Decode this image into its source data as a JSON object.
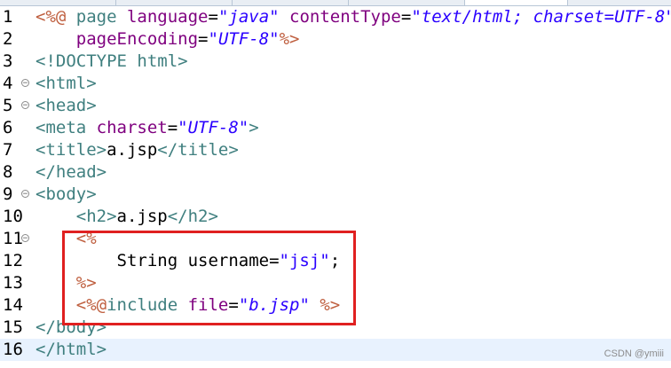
{
  "editor": {
    "lines": [
      {
        "num": "1",
        "fold": false,
        "segments": [
          {
            "t": "<%@ ",
            "c": "jsp"
          },
          {
            "t": "page ",
            "c": "tag"
          },
          {
            "t": "language",
            "c": "attr"
          },
          {
            "t": "=",
            "c": "plain"
          },
          {
            "t": "\"java\"",
            "c": "strit"
          },
          {
            "t": " ",
            "c": "plain"
          },
          {
            "t": "contentType",
            "c": "attr"
          },
          {
            "t": "=",
            "c": "plain"
          },
          {
            "t": "\"text/html; charset=UTF-8\"",
            "c": "strit"
          }
        ]
      },
      {
        "num": "2",
        "fold": false,
        "segments": [
          {
            "t": "    ",
            "c": "plain"
          },
          {
            "t": "pageEncoding",
            "c": "attr"
          },
          {
            "t": "=",
            "c": "plain"
          },
          {
            "t": "\"UTF-8\"",
            "c": "strit"
          },
          {
            "t": "%>",
            "c": "jsp"
          }
        ]
      },
      {
        "num": "3",
        "fold": false,
        "segments": [
          {
            "t": "<!DOCTYPE html>",
            "c": "tag"
          }
        ]
      },
      {
        "num": "4",
        "fold": true,
        "segments": [
          {
            "t": "<html>",
            "c": "tag"
          }
        ]
      },
      {
        "num": "5",
        "fold": true,
        "segments": [
          {
            "t": "<head>",
            "c": "tag"
          }
        ]
      },
      {
        "num": "6",
        "fold": false,
        "segments": [
          {
            "t": "<meta ",
            "c": "tag"
          },
          {
            "t": "charset",
            "c": "attr"
          },
          {
            "t": "=",
            "c": "plain"
          },
          {
            "t": "\"UTF-8\"",
            "c": "strit"
          },
          {
            "t": ">",
            "c": "tag"
          }
        ]
      },
      {
        "num": "7",
        "fold": false,
        "segments": [
          {
            "t": "<title>",
            "c": "tag"
          },
          {
            "t": "a.jsp",
            "c": "plain"
          },
          {
            "t": "</title>",
            "c": "tag"
          }
        ]
      },
      {
        "num": "8",
        "fold": false,
        "segments": [
          {
            "t": "</head>",
            "c": "tag"
          }
        ]
      },
      {
        "num": "9",
        "fold": true,
        "segments": [
          {
            "t": "<body>",
            "c": "tag"
          }
        ]
      },
      {
        "num": "10",
        "fold": false,
        "segments": [
          {
            "t": "    ",
            "c": "plain"
          },
          {
            "t": "<h2>",
            "c": "tag"
          },
          {
            "t": "a.jsp",
            "c": "plain"
          },
          {
            "t": "</h2>",
            "c": "tag"
          }
        ]
      },
      {
        "num": "11",
        "fold": true,
        "segments": [
          {
            "t": "    ",
            "c": "plain"
          },
          {
            "t": "<%",
            "c": "jsp"
          }
        ]
      },
      {
        "num": "12",
        "fold": false,
        "segments": [
          {
            "t": "        String username=",
            "c": "plain"
          },
          {
            "t": "\"jsj\"",
            "c": "str"
          },
          {
            "t": ";",
            "c": "plain"
          }
        ]
      },
      {
        "num": "13",
        "fold": false,
        "segments": [
          {
            "t": "    ",
            "c": "plain"
          },
          {
            "t": "%>",
            "c": "jsp"
          }
        ]
      },
      {
        "num": "14",
        "fold": false,
        "segments": [
          {
            "t": "    ",
            "c": "plain"
          },
          {
            "t": "<%@",
            "c": "jsp"
          },
          {
            "t": "include ",
            "c": "tag"
          },
          {
            "t": "file",
            "c": "attr"
          },
          {
            "t": "=",
            "c": "plain"
          },
          {
            "t": "\"b.jsp\"",
            "c": "strit"
          },
          {
            "t": " ",
            "c": "plain"
          },
          {
            "t": "%>",
            "c": "jsp"
          }
        ]
      },
      {
        "num": "15",
        "fold": false,
        "segments": [
          {
            "t": "</body>",
            "c": "tag"
          }
        ]
      },
      {
        "num": "16",
        "fold": false,
        "current": true,
        "segments": [
          {
            "t": "</html>",
            "c": "tag"
          }
        ]
      }
    ]
  },
  "watermark": "CSDN @ymiii",
  "colors": {
    "tag": "#3f7f7f",
    "attribute": "#7f007f",
    "string": "#2a00ff",
    "jsp_delimiter": "#bf5f3f",
    "highlight_box": "#e02020"
  }
}
